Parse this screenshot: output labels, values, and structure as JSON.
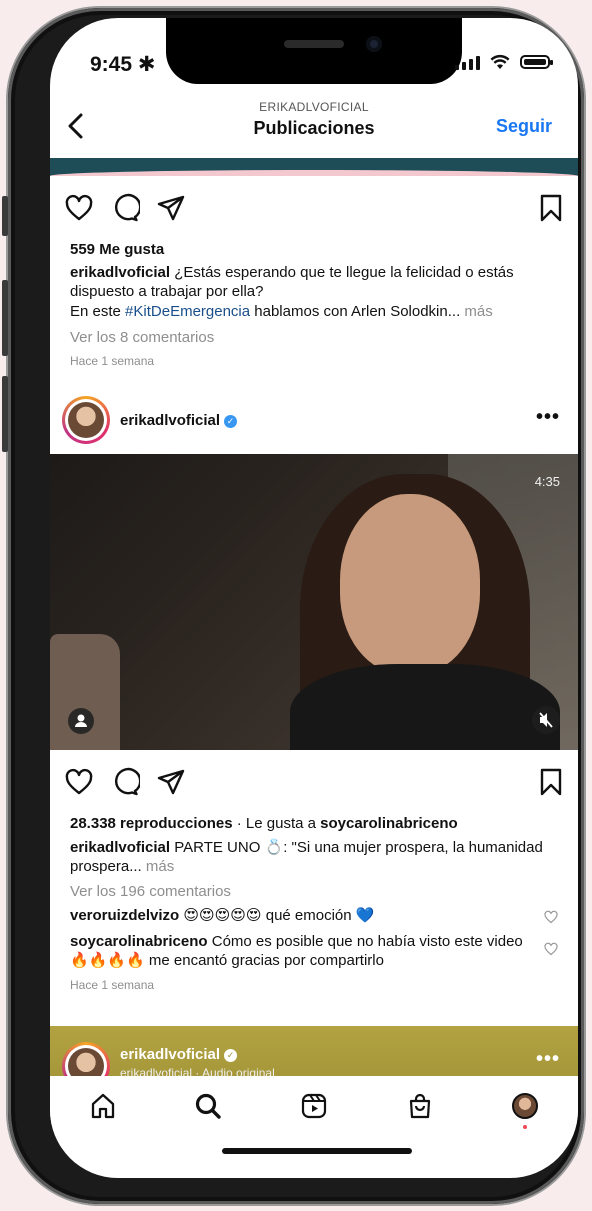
{
  "status": {
    "time": "9:45"
  },
  "header": {
    "account": "ERIKADLVOFICIAL",
    "title": "Publicaciones",
    "follow": "Seguir"
  },
  "post1": {
    "likes": "559 Me gusta",
    "username": "erikadlvoficial",
    "caption": "¿Estás esperando que te llegue la felicidad o estás dispuesto a trabajar por ella?",
    "line2_prefix": "En este ",
    "hashtag": "#KitDeEmergencia",
    "line2_rest": " hablamos con Arlen Solodkin...",
    "more": "más",
    "view_comments": "Ver los 8 comentarios",
    "time": "Hace 1 semana"
  },
  "post2": {
    "username": "erikadlvoficial",
    "verified": "✓",
    "video_duration": "4:35",
    "views": "28.338 reproducciones",
    "liked_by_prefix": " · Le gusta a ",
    "liked_by_user": "soycarolinabriceno",
    "caption_user": "erikadlvoficial",
    "caption": " PARTE UNO 💍: \"Si una mujer prospera, la humanidad prospera...",
    "more": "más",
    "view_comments": "Ver los 196 comentarios",
    "comments": [
      {
        "user": "veroruizdelvizo",
        "text": " 😍😍😍😍😍 qué emoción 💙"
      },
      {
        "user": "soycarolinabriceno",
        "text": " Cómo es posible que no había visto este video🔥🔥🔥🔥 me encantó gracias por compartirlo"
      }
    ],
    "time": "Hace 1 semana"
  },
  "post3": {
    "username": "erikadlvoficial",
    "verified": "✓",
    "audio": "erikadlvoficial · Audio original"
  },
  "colors": {
    "link": "#1877f2",
    "hashtag": "#1a4e8a",
    "verified": "#3897f0",
    "notification": "#ed4956"
  },
  "icons": [
    "heart-icon",
    "comment-icon",
    "share-icon",
    "bookmark-icon",
    "home-icon",
    "search-icon",
    "reels-icon",
    "shop-icon"
  ]
}
